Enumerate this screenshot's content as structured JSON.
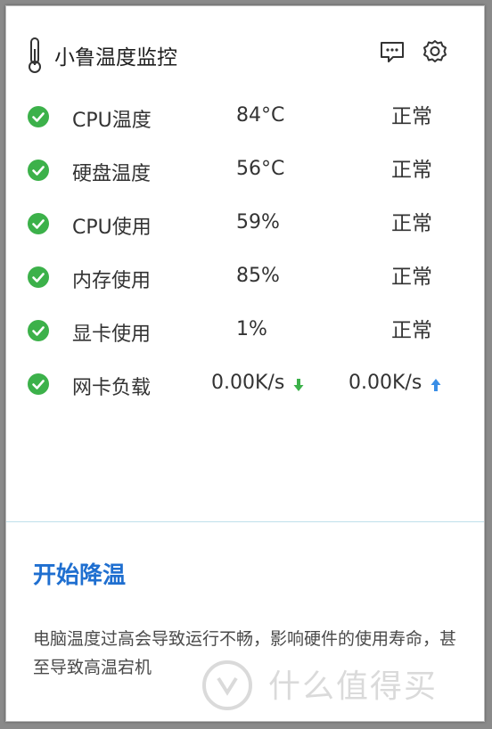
{
  "app": {
    "title": "小鲁温度监控"
  },
  "metrics": [
    {
      "name": "CPU温度",
      "value": "84°C",
      "status": "正常"
    },
    {
      "name": "硬盘温度",
      "value": "56°C",
      "status": "正常"
    },
    {
      "name": "CPU使用",
      "value": "59%",
      "status": "正常"
    },
    {
      "name": "内存使用",
      "value": "85%",
      "status": "正常"
    },
    {
      "name": "显卡使用",
      "value": "1%",
      "status": "正常"
    }
  ],
  "network": {
    "name": "网卡负载",
    "down": "0.00K/s",
    "up": "0.00K/s"
  },
  "cooling": {
    "title": "开始降温",
    "description": "电脑温度过高会导致运行不畅，影响硬件的使用寿命，甚至导致高温宕机"
  },
  "watermark": {
    "text": "什么值得买"
  },
  "colors": {
    "ok": "#3cb14a",
    "accent": "#1f6fd0",
    "down_arrow": "#3cb14a",
    "up_arrow": "#3a8ee6"
  },
  "icons": [
    "thermometer-icon",
    "message-icon",
    "gear-icon",
    "check-circle-icon",
    "arrow-down-icon",
    "arrow-up-icon"
  ]
}
